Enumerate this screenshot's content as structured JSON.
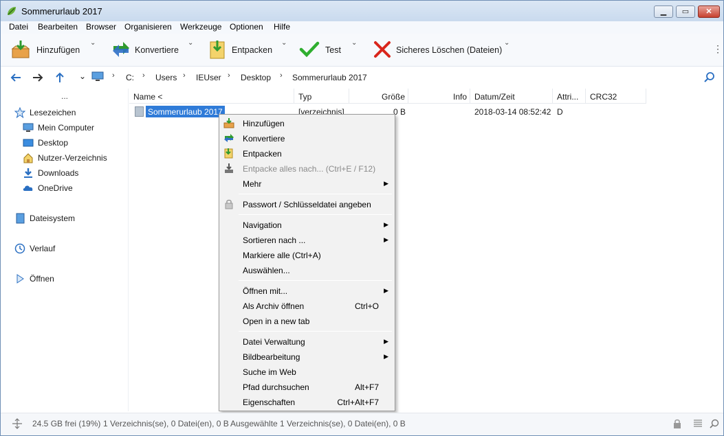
{
  "window": {
    "title": "Sommerurlaub 2017",
    "min_glyph": "▁",
    "max_glyph": "▭",
    "close_glyph": "✕"
  },
  "menubar": [
    "Datei",
    "Bearbeiten",
    "Browser",
    "Organisieren",
    "Werkzeuge",
    "Optionen",
    "Hilfe"
  ],
  "toolbar": {
    "add": "Hinzufügen",
    "convert": "Konvertiere",
    "extract": "Entpacken",
    "test": "Test",
    "delete": "Sicheres Löschen (Dateien)",
    "chevron": "⌄",
    "more": "⋮"
  },
  "address": {
    "crumbs": [
      "C:",
      "Users",
      "IEUser",
      "Desktop",
      "Sommerurlaub 2017"
    ],
    "sep": "›"
  },
  "sidebar": {
    "dots": "...",
    "bookmarks": "Lesezeichen",
    "items": [
      "Mein Computer",
      "Desktop",
      "Nutzer-Verzeichnis",
      "Downloads",
      "OneDrive"
    ],
    "filesystem": "Dateisystem",
    "history": "Verlauf",
    "open": "Öffnen"
  },
  "filelist": {
    "columns": [
      "Name <",
      "Typ",
      "Größe",
      "Info",
      "Datum/Zeit",
      "Attri...",
      "CRC32"
    ],
    "row": {
      "name": "Sommerurlaub 2017",
      "type": "[verzeichnis]",
      "size": "0 B",
      "info": "",
      "date": "2018-03-14 08:52:42",
      "attr": "D",
      "crc": ""
    }
  },
  "context_menu": {
    "items": [
      {
        "label": "Hinzufügen",
        "icon": "add-icon"
      },
      {
        "label": "Konvertiere",
        "icon": "convert-icon"
      },
      {
        "label": "Entpacken",
        "icon": "extract-icon"
      },
      {
        "label": "Entpacke alles nach... (Ctrl+E / F12)",
        "icon": "extract-all-icon",
        "disabled": true
      },
      {
        "label": "Mehr",
        "submenu": true
      },
      {
        "label": "Passwort / Schlüsseldatei angeben",
        "icon": "lock-icon"
      },
      {
        "label": "Navigation",
        "submenu": true
      },
      {
        "label": "Sortieren nach ...",
        "submenu": true
      },
      {
        "label": "Markiere alle (Ctrl+A)"
      },
      {
        "label": "Auswählen..."
      },
      {
        "label": "Öffnen mit...",
        "submenu": true
      },
      {
        "label": "Als Archiv öffnen",
        "shortcut": "Ctrl+O"
      },
      {
        "label": "Open in a new tab"
      },
      {
        "label": "Datei Verwaltung",
        "submenu": true
      },
      {
        "label": "Bildbearbeitung",
        "submenu": true
      },
      {
        "label": "Suche im Web"
      },
      {
        "label": "Pfad durchsuchen",
        "shortcut": "Alt+F7"
      },
      {
        "label": "Eigenschaften",
        "shortcut": "Ctrl+Alt+F7"
      }
    ],
    "arrow": "▶"
  },
  "status": {
    "free": "24.5 GB frei (19%)",
    "count": "1 Verzeichnis(se), 0 Datei(en), 0 B",
    "selected": "Ausgewählte 1 Verzeichnis(se), 0 Datei(en), 0 B"
  },
  "colors": {
    "selection": "#2f7bd8",
    "title_bar": "#c9daee",
    "close_button": "#c7402f"
  }
}
